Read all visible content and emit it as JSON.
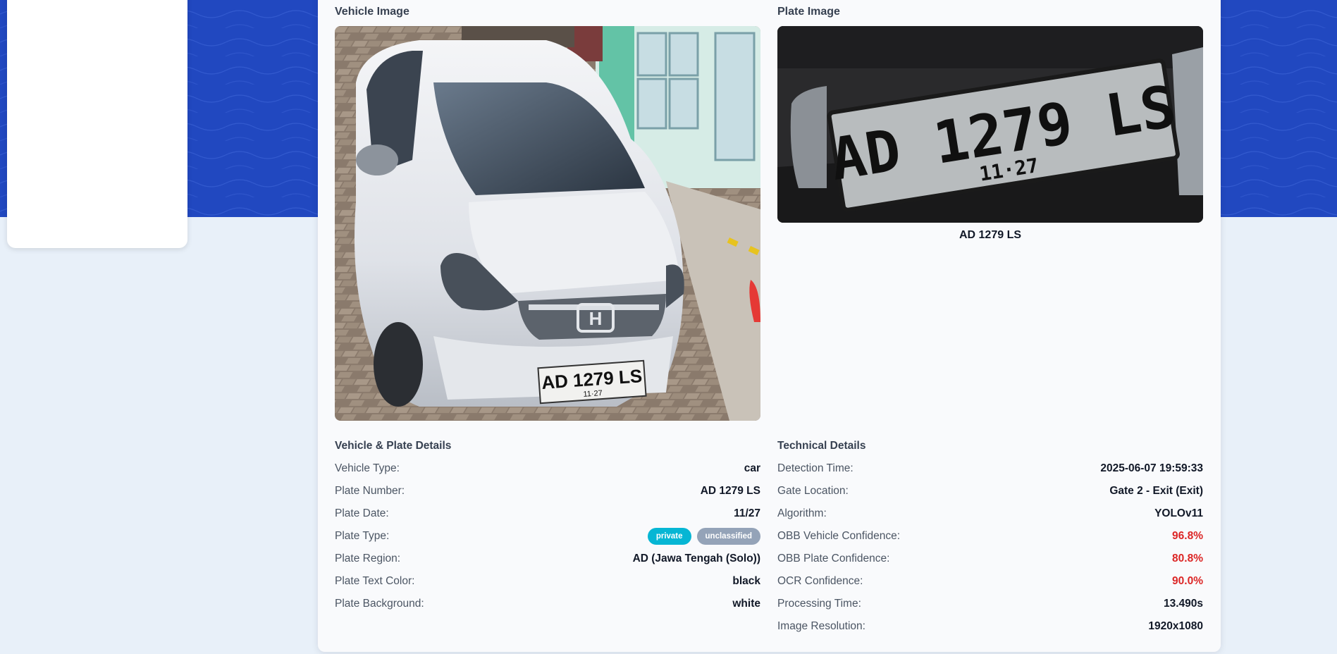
{
  "vehicle_image": {
    "title": "Vehicle Image",
    "plate_on_car": "AD 1279 LS",
    "plate_date_on_car": "11·27"
  },
  "plate_image": {
    "title": "Plate Image",
    "plate_text": "AD 1279 LS",
    "plate_date": "11·27",
    "caption": "AD 1279 LS"
  },
  "vehicle_details": {
    "title": "Vehicle & Plate Details",
    "rows": [
      {
        "label": "Vehicle Type:",
        "value": "car"
      },
      {
        "label": "Plate Number:",
        "value": "AD 1279 LS"
      },
      {
        "label": "Plate Date:",
        "value": "11/27"
      },
      {
        "label": "Plate Type:",
        "badges": [
          "private",
          "unclassified"
        ]
      },
      {
        "label": "Plate Region:",
        "value": "AD (Jawa Tengah (Solo))"
      },
      {
        "label": "Plate Text Color:",
        "value": "black"
      },
      {
        "label": "Plate Background:",
        "value": "white"
      }
    ]
  },
  "technical_details": {
    "title": "Technical Details",
    "rows": [
      {
        "label": "Detection Time:",
        "value": "2025-06-07 19:59:33"
      },
      {
        "label": "Gate Location:",
        "value": "Gate 2 - Exit (Exit)"
      },
      {
        "label": "Algorithm:",
        "value": "YOLOv11"
      },
      {
        "label": "OBB Vehicle Confidence:",
        "value": "96.8%"
      },
      {
        "label": "OBB Plate Confidence:",
        "value": "80.8%"
      },
      {
        "label": "OCR Confidence:",
        "value": "90.0%"
      },
      {
        "label": "Processing Time:",
        "value": "13.490s"
      },
      {
        "label": "Image Resolution:",
        "value": "1920x1080"
      }
    ]
  },
  "colors": {
    "hero_blue": "#2148c0",
    "page_bg": "#e8f0f9",
    "badge_private": "#06b6d4",
    "badge_unclassified": "#94a3b8",
    "confidence_red": "#dc2626"
  }
}
